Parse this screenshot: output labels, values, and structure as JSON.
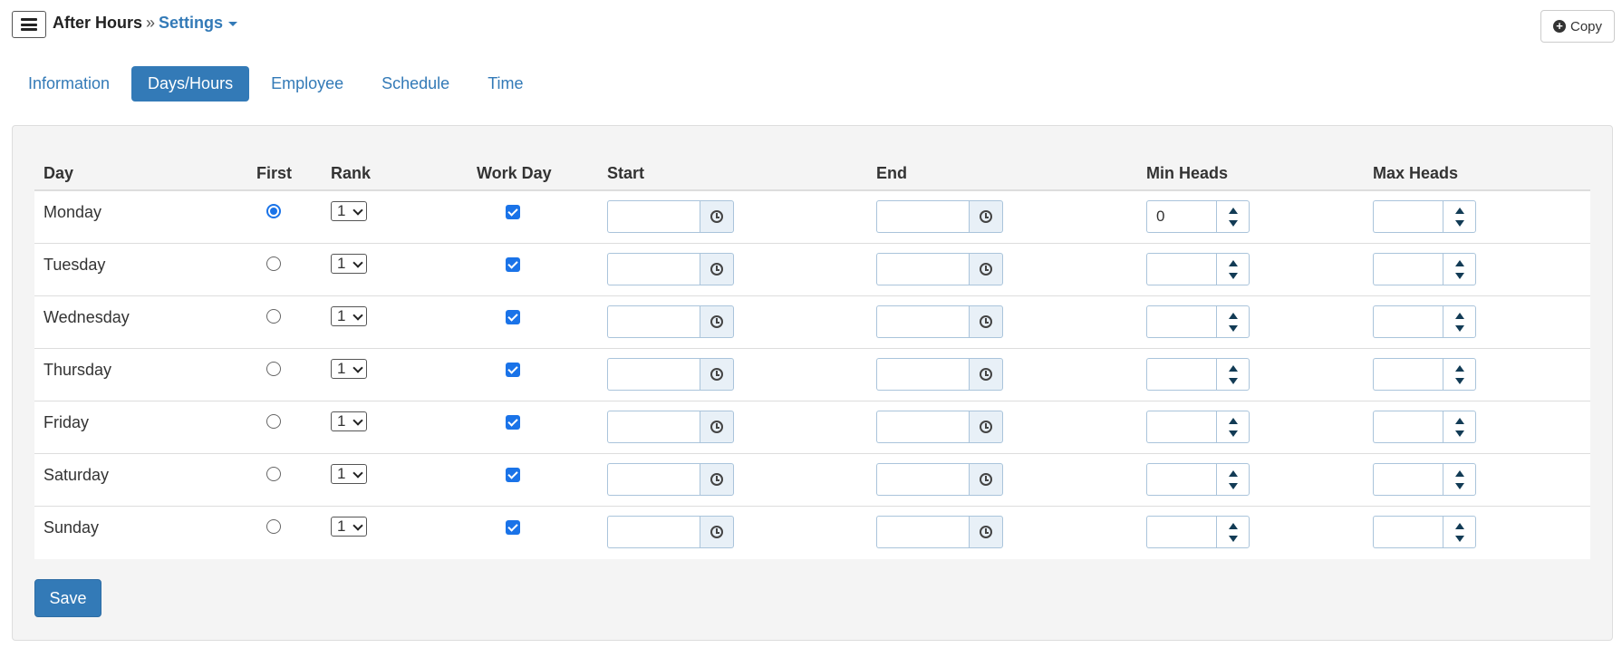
{
  "header": {
    "app_name": "After Hours",
    "separator": "»",
    "page_name": "Settings",
    "copy_label": "Copy"
  },
  "tabs": [
    {
      "label": "Information",
      "active": false
    },
    {
      "label": "Days/Hours",
      "active": true
    },
    {
      "label": "Employee",
      "active": false
    },
    {
      "label": "Schedule",
      "active": false
    },
    {
      "label": "Time",
      "active": false
    }
  ],
  "table": {
    "headers": {
      "day": "Day",
      "first": "First",
      "rank": "Rank",
      "work_day": "Work Day",
      "start": "Start",
      "end": "End",
      "min_heads": "Min Heads",
      "max_heads": "Max Heads"
    },
    "rows": [
      {
        "day": "Monday",
        "first": true,
        "rank": "1",
        "work_day": true,
        "start": "",
        "end": "",
        "min_heads": "0",
        "max_heads": ""
      },
      {
        "day": "Tuesday",
        "first": false,
        "rank": "1",
        "work_day": true,
        "start": "",
        "end": "",
        "min_heads": "",
        "max_heads": ""
      },
      {
        "day": "Wednesday",
        "first": false,
        "rank": "1",
        "work_day": true,
        "start": "",
        "end": "",
        "min_heads": "",
        "max_heads": ""
      },
      {
        "day": "Thursday",
        "first": false,
        "rank": "1",
        "work_day": true,
        "start": "",
        "end": "",
        "min_heads": "",
        "max_heads": ""
      },
      {
        "day": "Friday",
        "first": false,
        "rank": "1",
        "work_day": true,
        "start": "",
        "end": "",
        "min_heads": "",
        "max_heads": ""
      },
      {
        "day": "Saturday",
        "first": false,
        "rank": "1",
        "work_day": true,
        "start": "",
        "end": "",
        "min_heads": "",
        "max_heads": ""
      },
      {
        "day": "Sunday",
        "first": false,
        "rank": "1",
        "work_day": true,
        "start": "",
        "end": "",
        "min_heads": "",
        "max_heads": ""
      }
    ]
  },
  "actions": {
    "save_label": "Save"
  },
  "colors": {
    "accent": "#337ab7",
    "checkbox": "#1a73e8",
    "panel_bg": "#f4f4f4"
  }
}
